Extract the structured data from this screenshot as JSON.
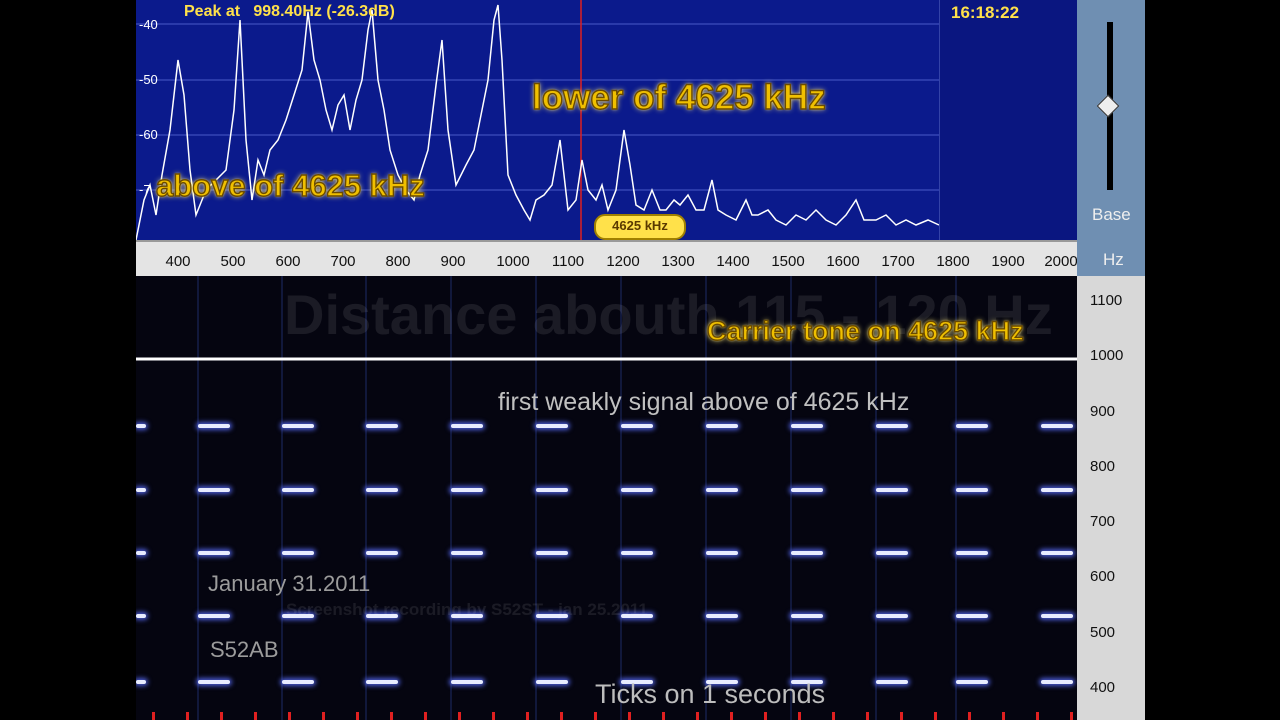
{
  "spectrum": {
    "peak_readout": "Peak at   998.40Hz (-26.3dB)",
    "clock": "16:18:22",
    "y_labels": [
      "-40",
      "-50",
      "-60",
      "-7"
    ],
    "x_labels": [
      "400",
      "500",
      "600",
      "700",
      "800",
      "900",
      "1000",
      "1100",
      "1200",
      "1300",
      "1400",
      "1500",
      "1600",
      "1700",
      "1800",
      "1900",
      "2000"
    ]
  },
  "side_panel": {
    "base_label": "Base",
    "hz_label": "Hz",
    "freq_labels": [
      "1100",
      "1000",
      "900",
      "800",
      "700",
      "600",
      "500",
      "400"
    ]
  },
  "annotations": {
    "lower": "lower of 4625 kHz",
    "above": "above of 4625 kHz",
    "tag": "4625 kHz",
    "carrier": "Carrier tone on 4625 kHz",
    "weak": "first weakly signal  above of 4625 kHz",
    "date": "January 31.2011",
    "callsign": "S52AB",
    "ticks": "Ticks on 1 seconds",
    "ghost_title": "Distance abouth 115 - 120 Hz",
    "ghost_credit": "Screenshot recording by S52ST - jan 25.2011"
  },
  "colors": {
    "spectrum_bg": "#0b1a8c",
    "annotation_yellow": "#f0c000",
    "waterfall_bg": "#050510",
    "marker_red": "#e02020"
  }
}
